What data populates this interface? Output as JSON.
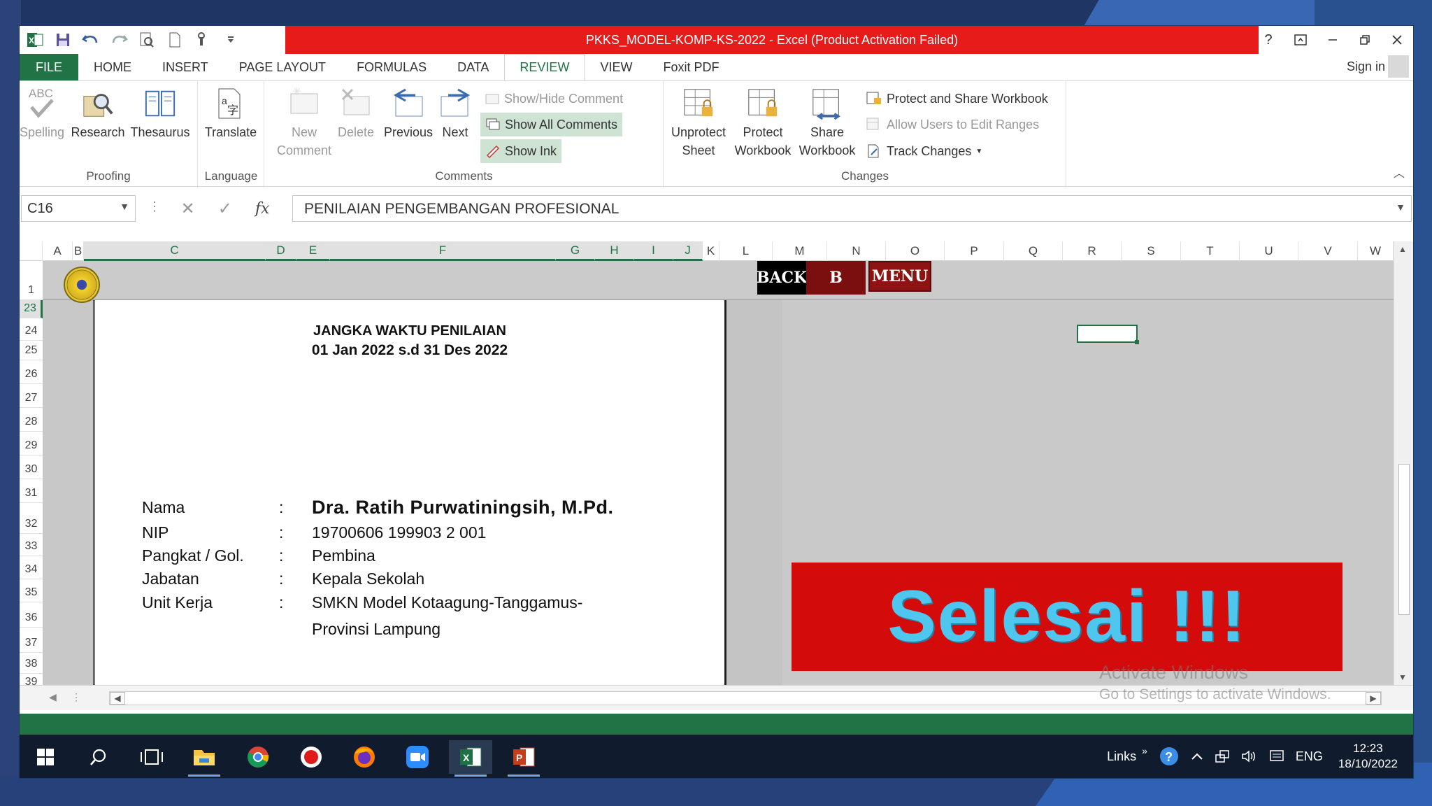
{
  "window": {
    "title": "PKKS_MODEL-KOMP-KS-2022 -  Excel (Product Activation Failed)",
    "help": "?",
    "sign_in": "Sign in"
  },
  "tabs": [
    "FILE",
    "HOME",
    "INSERT",
    "PAGE LAYOUT",
    "FORMULAS",
    "DATA",
    "REVIEW",
    "VIEW",
    "Foxit PDF"
  ],
  "active_tab": "REVIEW",
  "ribbon": {
    "proofing": {
      "label": "Proofing",
      "spelling": "Spelling",
      "spelling_icon_text": "ABC",
      "research": "Research",
      "thesaurus": "Thesaurus"
    },
    "language": {
      "label": "Language",
      "translate": "Translate"
    },
    "comments": {
      "label": "Comments",
      "new_comment_1": "New",
      "new_comment_2": "Comment",
      "delete": "Delete",
      "previous": "Previous",
      "next": "Next",
      "show_hide": "Show/Hide Comment",
      "show_all": "Show All Comments",
      "show_ink": "Show Ink"
    },
    "changes": {
      "label": "Changes",
      "unprotect_1": "Unprotect",
      "unprotect_2": "Sheet",
      "protect_1": "Protect",
      "protect_2": "Workbook",
      "share_1": "Share",
      "share_2": "Workbook",
      "protect_share": "Protect and Share Workbook",
      "allow_users": "Allow Users to Edit Ranges",
      "track_changes": "Track Changes"
    }
  },
  "formula_bar": {
    "name_box": "C16",
    "fx": "fx",
    "content": "PENILAIAN PENGEMBANGAN PROFESIONAL"
  },
  "columns": [
    "A",
    "B",
    "C",
    "D",
    "E",
    "F",
    "G",
    "H",
    "I",
    "J",
    "K",
    "L",
    "M",
    "N",
    "O",
    "P",
    "Q",
    "R",
    "S",
    "T",
    "U",
    "V",
    "W"
  ],
  "rows": [
    "1",
    "23",
    "24",
    "25",
    "26",
    "27",
    "28",
    "29",
    "30",
    "31",
    "32",
    "33",
    "34",
    "35",
    "36",
    "37",
    "38",
    "39"
  ],
  "nav_buttons": {
    "back": "BACK",
    "b": "B",
    "menu": "MENU"
  },
  "document": {
    "heading_1": "JANGKA WAKTU PENILAIAN",
    "heading_2": "01 Jan 2022 s.d 31 Des 2022",
    "fields": [
      {
        "key": "Nama",
        "colon": ":",
        "value": "Dra. Ratih Purwatiningsih, M.Pd."
      },
      {
        "key": "NIP",
        "colon": ":",
        "value": "19700606 199903 2 001"
      },
      {
        "key": "Pangkat / Gol.",
        "colon": ":",
        "value": "Pembina"
      },
      {
        "key": "Jabatan",
        "colon": ":",
        "value": "Kepala Sekolah"
      },
      {
        "key": "Unit Kerja",
        "colon": ":",
        "value": "SMKN Model Kotaagung-Tanggamus-"
      }
    ],
    "unit_kerja_line2": "Provinsi Lampung"
  },
  "banner": {
    "text": "Selesai !!!",
    "bg_color": "#d40b0b",
    "text_color": "#4ec6ee"
  },
  "watermark": {
    "line1": "Activate Windows",
    "line2": "Go to Settings to activate Windows."
  },
  "taskbar": {
    "links": "Links",
    "language": "ENG",
    "time": "12:23",
    "date": "18/10/2022"
  },
  "colors": {
    "excel_green": "#217346",
    "title_red": "#e81b1b"
  }
}
